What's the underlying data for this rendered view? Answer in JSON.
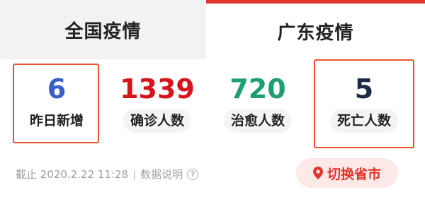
{
  "tabs": {
    "national": "全国疫情",
    "guangdong": "广东疫情"
  },
  "stats": {
    "yesterday": {
      "value": "6",
      "label": "昨日新增",
      "color": "#3a5fc8"
    },
    "confirmed": {
      "value": "1339",
      "label": "确诊人数",
      "color": "#d6141c"
    },
    "cured": {
      "value": "720",
      "label": "治愈人数",
      "color": "#1f9e73"
    },
    "deaths": {
      "value": "5",
      "label": "死亡人数",
      "color": "#1c2a44"
    }
  },
  "footer": {
    "as_of": "截止 2020.2.22 11:28",
    "separator": "|",
    "explain": "数据说明",
    "help_icon": "?"
  },
  "switch": {
    "label": "切换省市",
    "icon": "location-pin-icon",
    "accent": "#e0342d"
  }
}
